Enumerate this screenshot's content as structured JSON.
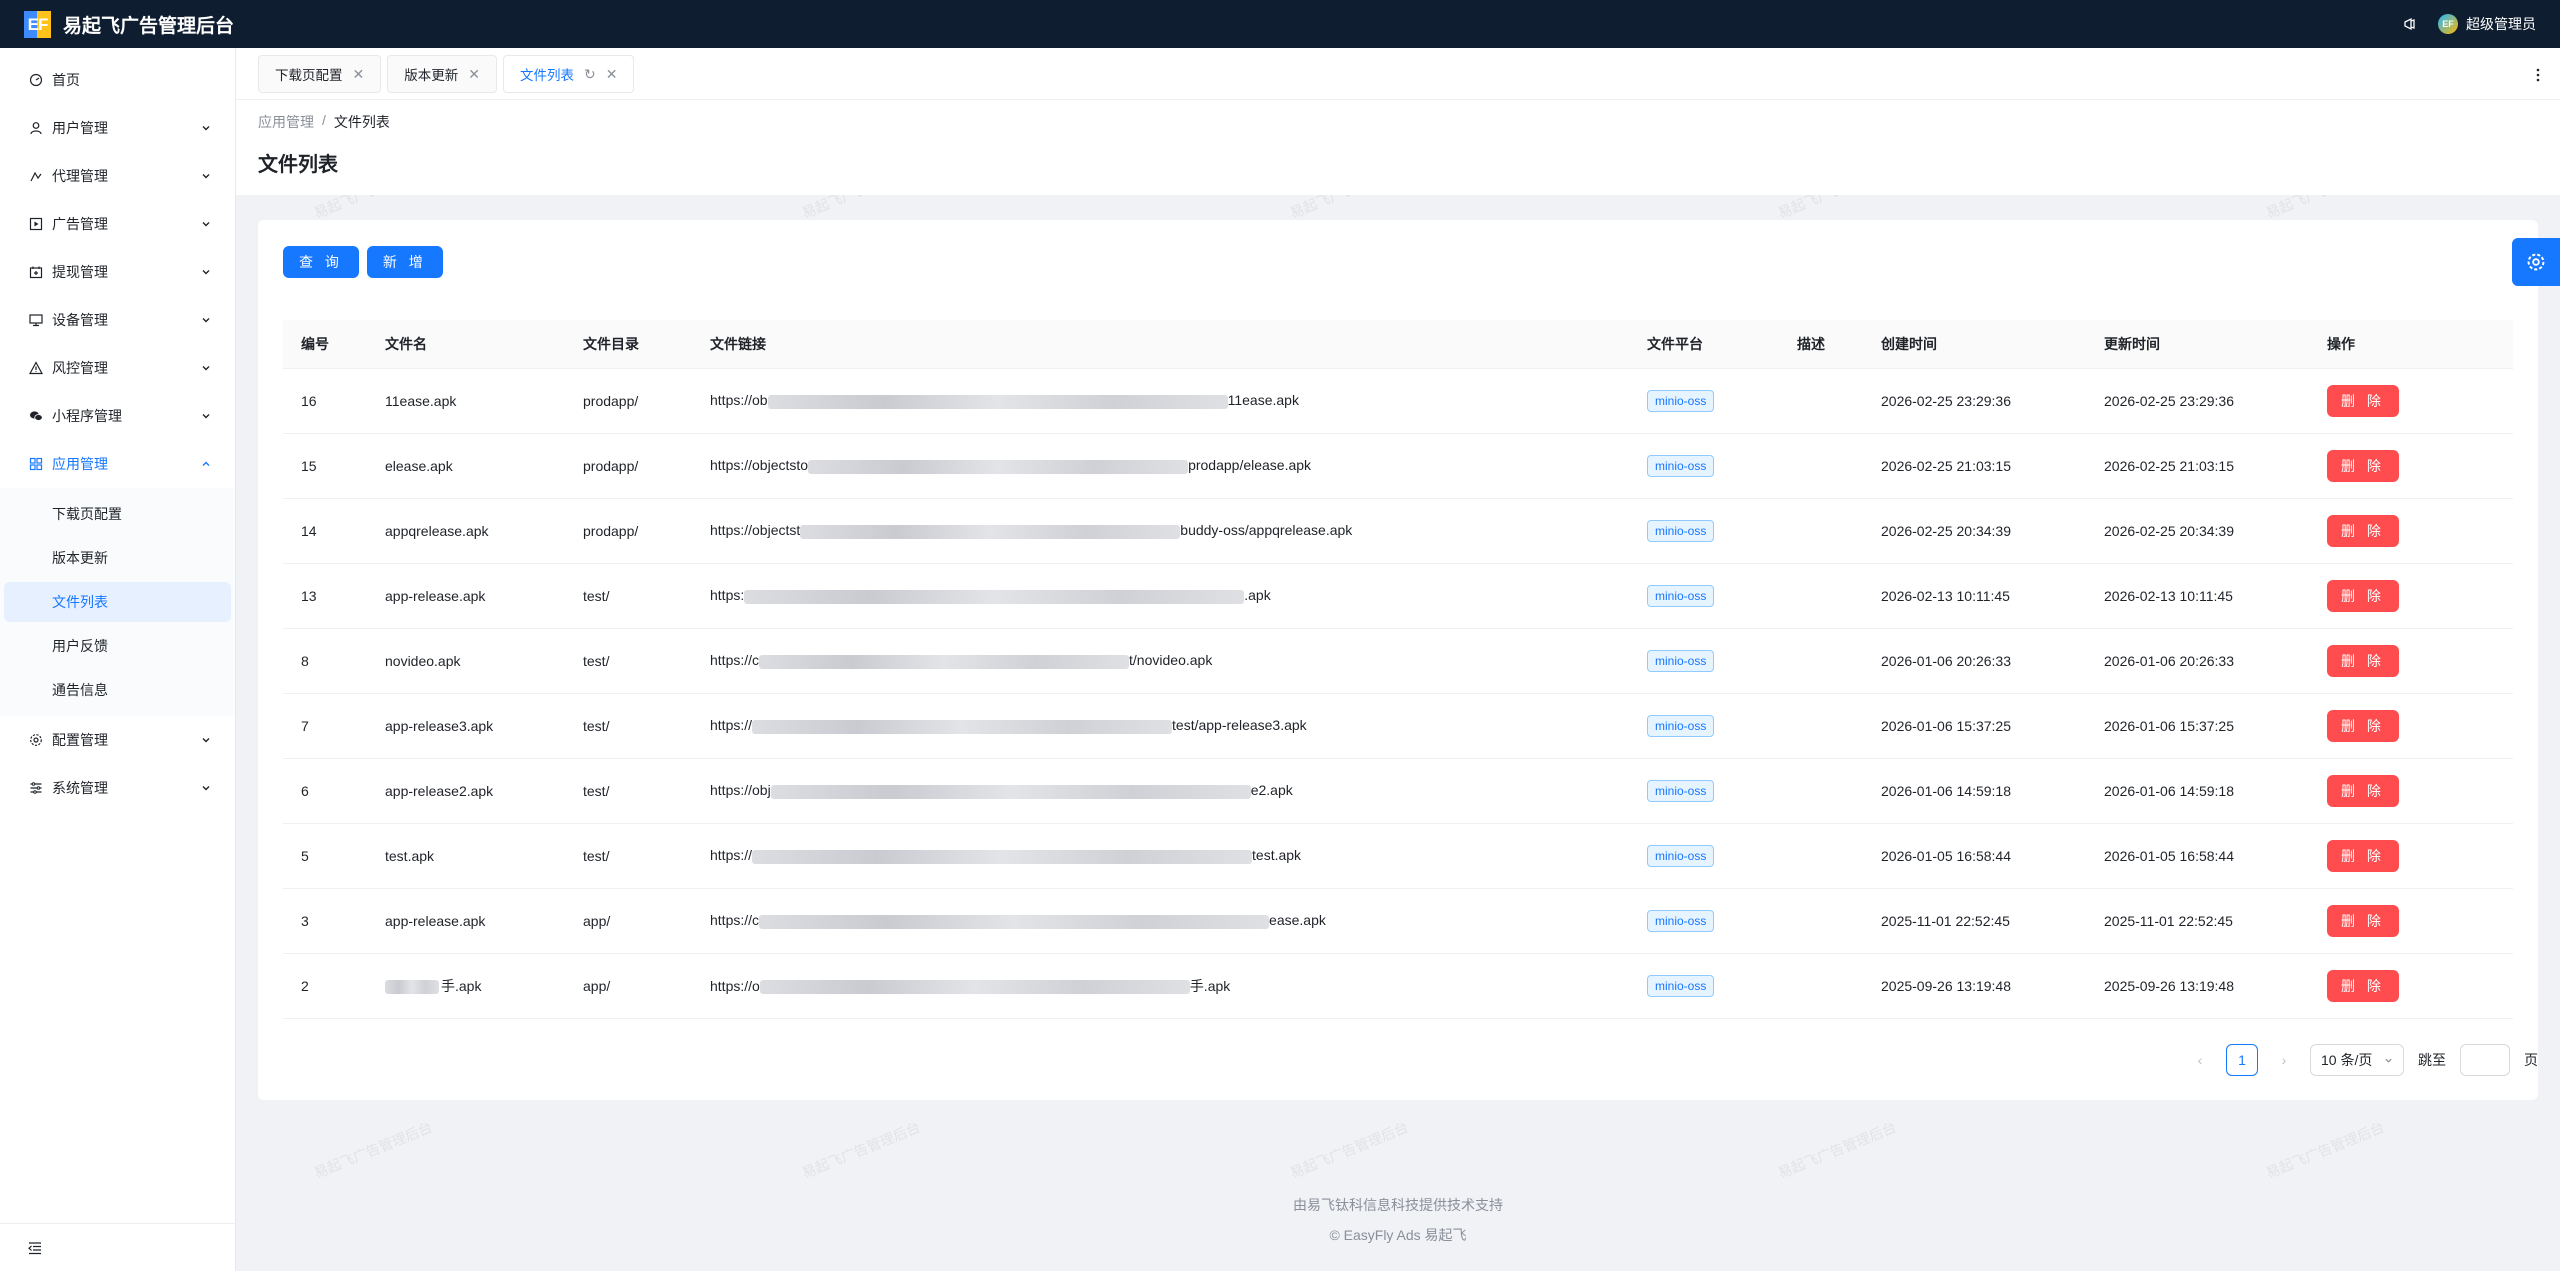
{
  "app": {
    "logo_text": "EF",
    "title": "易起飞广告管理后台",
    "user_name": "超级管理员",
    "avatar_text": "EF"
  },
  "sidebar": {
    "items": [
      {
        "label": "首页",
        "icon": "dashboard-icon"
      },
      {
        "label": "用户管理",
        "icon": "user-icon"
      },
      {
        "label": "代理管理",
        "icon": "agent-icon"
      },
      {
        "label": "广告管理",
        "icon": "ad-icon"
      },
      {
        "label": "提现管理",
        "icon": "withdraw-icon"
      },
      {
        "label": "设备管理",
        "icon": "device-icon"
      },
      {
        "label": "风控管理",
        "icon": "warning-icon"
      },
      {
        "label": "小程序管理",
        "icon": "wechat-icon"
      },
      {
        "label": "应用管理",
        "icon": "app-grid-icon"
      },
      {
        "label": "配置管理",
        "icon": "gear-icon"
      },
      {
        "label": "系统管理",
        "icon": "system-icon"
      }
    ],
    "submenu": [
      "下载页配置",
      "版本更新",
      "文件列表",
      "用户反馈",
      "通告信息"
    ],
    "selected_sub": "文件列表"
  },
  "tabs": [
    {
      "label": "下载页配置"
    },
    {
      "label": "版本更新"
    },
    {
      "label": "文件列表"
    }
  ],
  "breadcrumb": {
    "parent": "应用管理",
    "separator": "/",
    "current": "文件列表"
  },
  "page_title": "文件列表",
  "toolbar": {
    "query_label": "查 询",
    "add_label": "新 增"
  },
  "table": {
    "columns": [
      "编号",
      "文件名",
      "文件目录",
      "文件链接",
      "文件平台",
      "描述",
      "创建时间",
      "更新时间",
      "操作"
    ],
    "delete_label": "删 除",
    "rows": [
      {
        "id": "16",
        "name": "11ease.apk",
        "dir": "prodapp/",
        "link_start": "https://ob",
        "link_end": "11ease.apk",
        "platform": "minio-oss",
        "desc": "",
        "created": "2026-02-25 23:29:36",
        "updated": "2026-02-25 23:29:36"
      },
      {
        "id": "15",
        "name": "elease.apk",
        "dir": "prodapp/",
        "link_start": "https://objectsto",
        "link_end": "prodapp/elease.apk",
        "platform": "minio-oss",
        "desc": "",
        "created": "2026-02-25 21:03:15",
        "updated": "2026-02-25 21:03:15"
      },
      {
        "id": "14",
        "name": "appqrelease.apk",
        "dir": "prodapp/",
        "link_start": "https://objectst",
        "link_end": "buddy-oss/appqrelease.apk",
        "platform": "minio-oss",
        "desc": "",
        "created": "2026-02-25 20:34:39",
        "updated": "2026-02-25 20:34:39"
      },
      {
        "id": "13",
        "name": "app-release.apk",
        "dir": "test/",
        "link_start": "https:",
        "link_end": ".apk",
        "platform": "minio-oss",
        "desc": "",
        "created": "2026-02-13 10:11:45",
        "updated": "2026-02-13 10:11:45"
      },
      {
        "id": "8",
        "name": "novideo.apk",
        "dir": "test/",
        "link_start": "https://c",
        "link_end": "t/novideo.apk",
        "platform": "minio-oss",
        "desc": "",
        "created": "2026-01-06 20:26:33",
        "updated": "2026-01-06 20:26:33"
      },
      {
        "id": "7",
        "name": "app-release3.apk",
        "dir": "test/",
        "link_start": "https://",
        "link_end": "test/app-release3.apk",
        "platform": "minio-oss",
        "desc": "",
        "created": "2026-01-06 15:37:25",
        "updated": "2026-01-06 15:37:25"
      },
      {
        "id": "6",
        "name": "app-release2.apk",
        "dir": "test/",
        "link_start": "https://obj",
        "link_end": "e2.apk",
        "platform": "minio-oss",
        "desc": "",
        "created": "2026-01-06 14:59:18",
        "updated": "2026-01-06 14:59:18"
      },
      {
        "id": "5",
        "name": "test.apk",
        "dir": "test/",
        "link_start": "https://",
        "link_end": "test.apk",
        "platform": "minio-oss",
        "desc": "",
        "created": "2026-01-05 16:58:44",
        "updated": "2026-01-05 16:58:44"
      },
      {
        "id": "3",
        "name": "app-release.apk",
        "dir": "app/",
        "link_start": "https://c",
        "link_end": "ease.apk",
        "platform": "minio-oss",
        "desc": "",
        "created": "2025-11-01 22:52:45",
        "updated": "2025-11-01 22:52:45"
      },
      {
        "id": "2",
        "name": "手.apk",
        "dir": "app/",
        "link_start": "https://o",
        "link_end": "手.apk",
        "platform": "minio-oss",
        "desc": "",
        "created": "2025-09-26 13:19:48",
        "updated": "2025-09-26 13:19:48"
      }
    ]
  },
  "pagination": {
    "current_page": "1",
    "page_size": "10 条/页",
    "jump_label": "跳至",
    "page_unit": "页"
  },
  "footer": {
    "line1": "由易飞钛科信息科技提供技术支持",
    "line2": "© EasyFly Ads 易起飞"
  },
  "watermark": "易起飞广告管理后台",
  "colors": {
    "primary": "#1677ff",
    "danger": "#ff4d4f",
    "topbar": "#0f1d31"
  }
}
